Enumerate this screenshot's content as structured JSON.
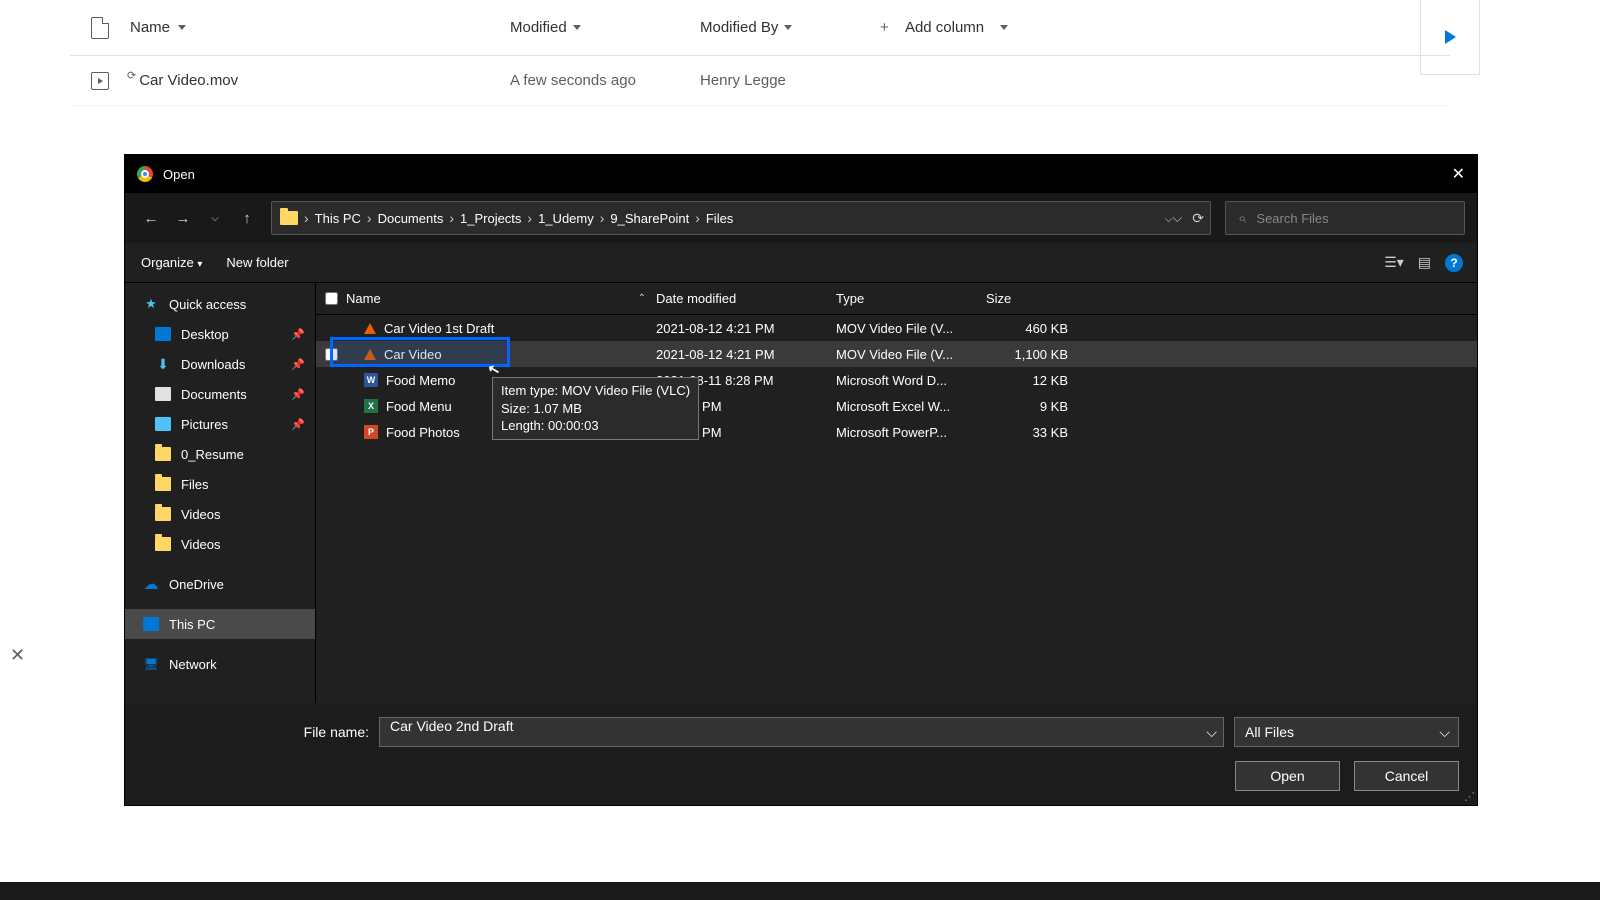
{
  "sharepoint": {
    "columns": {
      "name": "Name",
      "modified": "Modified",
      "modified_by": "Modified By",
      "add": "Add column"
    },
    "row": {
      "name": "Car Video.mov",
      "modified": "A few seconds ago",
      "by": "Henry Legge"
    }
  },
  "dialog": {
    "title": "Open",
    "breadcrumb": [
      "This PC",
      "Documents",
      "1_Projects",
      "1_Udemy",
      "9_SharePoint",
      "Files"
    ],
    "search_placeholder": "Search Files",
    "toolbar": {
      "organize": "Organize",
      "new_folder": "New folder"
    },
    "sidebar": {
      "quick": "Quick access",
      "desktop": "Desktop",
      "downloads": "Downloads",
      "documents": "Documents",
      "pictures": "Pictures",
      "resume": "0_Resume",
      "files": "Files",
      "videos1": "Videos",
      "videos2": "Videos",
      "onedrive": "OneDrive",
      "thispc": "This PC",
      "network": "Network"
    },
    "columns": {
      "name": "Name",
      "date": "Date modified",
      "type": "Type",
      "size": "Size"
    },
    "files": [
      {
        "name": "Car Video 1st Draft",
        "date": "2021-08-12 4:21 PM",
        "type": "MOV Video File (V...",
        "size": "460 KB",
        "icon": "vlc"
      },
      {
        "name": "Car Video",
        "date": "2021-08-12 4:21 PM",
        "type": "MOV Video File (V...",
        "size": "1,100 KB",
        "icon": "vlc"
      },
      {
        "name": "Food Memo",
        "date": "2021-08-11 8:28 PM",
        "type": "Microsoft Word D...",
        "size": "12 KB",
        "icon": "word"
      },
      {
        "name": "Food Menu",
        "date": "11 8:29 PM",
        "type": "Microsoft Excel W...",
        "size": "9 KB",
        "icon": "excel"
      },
      {
        "name": "Food Photos",
        "date": "11 8:29 PM",
        "type": "Microsoft PowerP...",
        "size": "33 KB",
        "icon": "ppt"
      }
    ],
    "tooltip": {
      "l1": "Item type: MOV Video File (VLC)",
      "l2": "Size: 1.07 MB",
      "l3": "Length: 00:00:03"
    },
    "filename_label": "File name:",
    "filename_value": "Car Video 2nd Draft",
    "filter": "All Files",
    "open": "Open",
    "cancel": "Cancel"
  }
}
